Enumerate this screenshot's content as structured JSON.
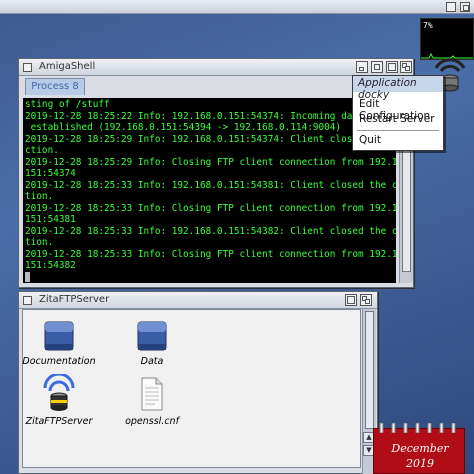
{
  "monitor": {
    "readout": "7%"
  },
  "shell_window": {
    "title": "AmigaShell",
    "tab_label": "Process 8",
    "terminal_lines": [
      "sting of /stuff",
      "2019-12-28 18:25:22 Info: 192.168.0.151:54374: Incoming data co",
      " established (192.168.0.151:54394 -> 192.168.0.114:9004)",
      "2019-12-28 18:25:29 Info: 192.168.0.151:54374: Client closed th",
      "ction.",
      "2019-12-28 18:25:29 Info: Closing FTP client connection from 192.168.0.",
      "151:54374",
      "2019-12-28 18:25:33 Info: 192.168.0.151:54381: Client closed the connec",
      "tion.",
      "2019-12-28 18:25:33 Info: Closing FTP client connection from 192.168.0.",
      "151:54381",
      "2019-12-28 18:25:33 Info: 192.168.0.151:54382: Client closed the connec",
      "tion.",
      "2019-12-28 18:25:33 Info: Closing FTP client connection from 192.168.0.",
      "151:54382"
    ]
  },
  "context_menu": {
    "header": "Application docky",
    "items": [
      "Edit Configuration",
      "Restart Server",
      "Quit"
    ]
  },
  "files_window": {
    "title": "ZitaFTPServer",
    "icons": [
      {
        "label": "Documentation",
        "icon": "drawer-icon"
      },
      {
        "label": "Data",
        "icon": "drawer-icon"
      },
      {
        "label": "ZitaFTPServer",
        "icon": "server-app-icon"
      },
      {
        "label": "openssl.cnf",
        "icon": "text-file-icon"
      }
    ]
  },
  "calendar": {
    "month": "December",
    "year": "2019"
  },
  "colors": {
    "terminal_text": "#39ff39",
    "terminal_bg": "#000000",
    "calendar_red": "#b10d16",
    "tab_text": "#4466aa"
  }
}
